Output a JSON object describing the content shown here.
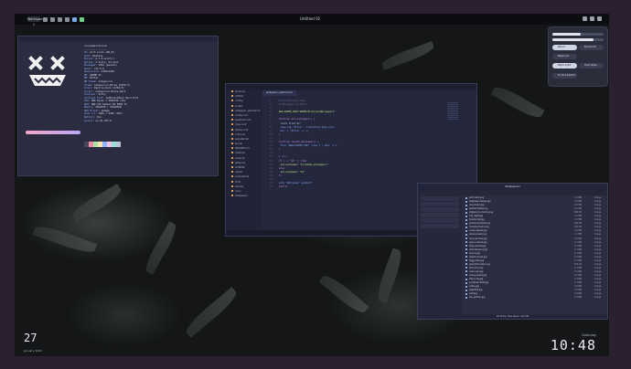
{
  "topbar": {
    "workspace_label": "Workspace 1",
    "window_title": "Untitled 01"
  },
  "neofetch": {
    "lines": [
      {
        "k": "",
        "v": "vivian@archlinux"
      },
      {
        "k": "",
        "v": "----------------"
      },
      {
        "k": "OS: ",
        "v": "Arch Linux x86_64"
      },
      {
        "k": "Host: ",
        "v": "Desktop"
      },
      {
        "k": "Kernel: ",
        "v": "6.7.0-arch3-1"
      },
      {
        "k": "Uptime: ",
        "v": "3 hours, 22 mins"
      },
      {
        "k": "Packages: ",
        "v": "1094 (pacman)"
      },
      {
        "k": "Shell: ",
        "v": "zsh 5.9"
      },
      {
        "k": "Resolution: ",
        "v": "2560x1440"
      },
      {
        "k": "DE: ",
        "v": "GNOME 45"
      },
      {
        "k": "WM: ",
        "v": "Mutter"
      },
      {
        "k": "WM Theme: ",
        "v": "Catppuccin"
      },
      {
        "k": "Theme: ",
        "v": "Catppuccin-Mocha [GTK2/3]"
      },
      {
        "k": "Icons: ",
        "v": "Papirus-Dark [GTK2/3]"
      },
      {
        "k": "Cursor: ",
        "v": "Catppuccin-Mocha-Dark"
      },
      {
        "k": "Terminal: ",
        "v": "kitty"
      },
      {
        "k": "Terminal Font: ",
        "v": "JetBrainsMono Nerd Font"
      },
      {
        "k": "CPU: ",
        "v": "AMD Ryzen 7 5800X3D (16)"
      },
      {
        "k": "GPU: ",
        "v": "AMD ATI Radeon RX 6800 XT"
      },
      {
        "k": "Memory: ",
        "v": "4812MiB / 32030MiB"
      },
      {
        "k": "GPU Driver: ",
        "v": "amdgpu"
      },
      {
        "k": "Disk (/): ",
        "v": "182G / 930G (20%)"
      },
      {
        "k": "Battery: ",
        "v": "N/A"
      },
      {
        "k": "Locale: ",
        "v": "en_US.UTF-8"
      }
    ],
    "swatch_colors": [
      "#45475a",
      "#f38ba8",
      "#a6e3a1",
      "#f9e2af",
      "#89b4fa",
      "#f5c2e7",
      "#94e2d5",
      "#bac2de"
    ]
  },
  "editor": {
    "tab_label": "wallpaper_switcher.sh",
    "sidebar_items": [
      "archlinux",
      "dotfiles",
      ".config",
      "scripts",
      "wallpaper_switcher.sh",
      "config.conf",
      "keybinds.conf",
      "rules.conf",
      "theme.conf",
      "colors.sh",
      "autostart.sh",
      "env.sh",
      "README.md",
      "install.sh",
      "setup.sh",
      "gitignore",
      "LICENSE",
      "assets",
      "screenshots",
      "fonts",
      "themes",
      "icons",
      "wallpapers"
    ],
    "code_lines": [
      {
        "n": "1",
        "t": "#!/usr/bin/env bash",
        "c": "cm"
      },
      {
        "n": "2",
        "t": "# wallpaper switcher",
        "c": "cm"
      },
      {
        "n": "3",
        "t": "",
        "c": ""
      },
      {
        "n": "4",
        "t": "WALLPAPER_DIR=\"$HOME/Pictures/Wallpapers\"",
        "c": "str"
      },
      {
        "n": "5",
        "t": "",
        "c": ""
      },
      {
        "n": "6",
        "t": "function set_wallpaper() {",
        "c": "kw"
      },
      {
        "n": "7",
        "t": "    local file=\"$1\"",
        "c": ""
      },
      {
        "n": "8",
        "t": "    swww img \"$file\" --transition-type grow",
        "c": "fn"
      },
      {
        "n": "9",
        "t": "    wal -i \"$file\" -n -q",
        "c": "fn"
      },
      {
        "n": "10",
        "t": "}",
        "c": "kw"
      },
      {
        "n": "11",
        "t": "",
        "c": ""
      },
      {
        "n": "12",
        "t": "function random_wallpaper() {",
        "c": "kw"
      },
      {
        "n": "13",
        "t": "    find \"$WALLPAPER_DIR\" -type f | shuf -n 1",
        "c": "fn"
      },
      {
        "n": "14",
        "t": "}",
        "c": "kw"
      },
      {
        "n": "15",
        "t": "",
        "c": ""
      },
      {
        "n": "16",
        "t": "# main",
        "c": "cm"
      },
      {
        "n": "17",
        "t": "if [ -z \"$1\" ]; then",
        "c": "kw"
      },
      {
        "n": "18",
        "t": "    set_wallpaper \"$(random_wallpaper)\"",
        "c": "str"
      },
      {
        "n": "19",
        "t": "else",
        "c": "kw"
      },
      {
        "n": "20",
        "t": "    set_wallpaper \"$1\"",
        "c": "str"
      },
      {
        "n": "21",
        "t": "fi",
        "c": "kw"
      },
      {
        "n": "22",
        "t": "",
        "c": ""
      },
      {
        "n": "23",
        "t": "echo \"Wallpaper updated\"",
        "c": "fn"
      },
      {
        "n": "24",
        "t": "exit 0",
        "c": "kw"
      }
    ]
  },
  "filemanager": {
    "title": "Wallpapers",
    "files": [
      {
        "n": "arch-dark.png",
        "s": "1.2 MB",
        "t": "Image"
      },
      {
        "n": "wallpaper-leaves.jpg",
        "s": "3.4 MB",
        "t": "Image"
      },
      {
        "n": "mountains.jpg",
        "s": "2.8 MB",
        "t": "Image"
      },
      {
        "n": "abstract-flow.png",
        "s": "4.1 MB",
        "t": "Image"
      },
      {
        "n": "catppuccin-mocha.png",
        "s": "980 kB",
        "t": "Image"
      },
      {
        "n": "city-night.jpg",
        "s": "2.2 MB",
        "t": "Image"
      },
      {
        "n": "forest-mist.jpg",
        "s": "3.0 MB",
        "t": "Image"
      },
      {
        "n": "gradient-purple.png",
        "s": "620 kB",
        "t": "Image"
      },
      {
        "n": "minimal-moon.png",
        "s": "450 kB",
        "t": "Image"
      },
      {
        "n": "ocean-waves.jpg",
        "s": "2.6 MB",
        "t": "Image"
      },
      {
        "n": "pixel-sunset.png",
        "s": "1.1 MB",
        "t": "Image"
      },
      {
        "n": "rainy-window.jpg",
        "s": "2.9 MB",
        "t": "Image"
      },
      {
        "n": "space-nebula.jpg",
        "s": "5.2 MB",
        "t": "Image"
      },
      {
        "n": "tokyo-street.jpg",
        "s": "3.3 MB",
        "t": "Image"
      },
      {
        "n": "dark-leaves-2.jpg",
        "s": "3.7 MB",
        "t": "Image"
      },
      {
        "n": "aurora.jpg",
        "s": "2.4 MB",
        "t": "Image"
      },
      {
        "n": "desert-dunes.jpg",
        "s": "1.9 MB",
        "t": "Image"
      },
      {
        "n": "foggy-lake.jpg",
        "s": "2.1 MB",
        "t": "Image"
      },
      {
        "n": "geometric-dark.png",
        "s": "870 kB",
        "t": "Image"
      },
      {
        "n": "lofi-room.png",
        "s": "1.5 MB",
        "t": "Image"
      },
      {
        "n": "neon-rain.jpg",
        "s": "3.1 MB",
        "t": "Image"
      },
      {
        "n": "snowy-peaks.jpg",
        "s": "2.7 MB",
        "t": "Image"
      },
      {
        "n": "starry-sky.jpg",
        "s": "3.9 MB",
        "t": "Image"
      },
      {
        "n": "sunflower-field.jpg",
        "s": "2.3 MB",
        "t": "Image"
      },
      {
        "n": "valley.jpg",
        "s": "2.0 MB",
        "t": "Image"
      },
      {
        "n": "waterfall.jpg",
        "s": "3.5 MB",
        "t": "Image"
      },
      {
        "n": "wolf.jpg",
        "s": "1.8 MB",
        "t": "Image"
      },
      {
        "n": "zen-garden.jpg",
        "s": "2.5 MB",
        "t": "Image"
      }
    ],
    "status": "28 items, Free space: 412 GB"
  },
  "quicksettings": {
    "wifi": "Wired",
    "bluetooth": "Bluetooth",
    "power": "Balanced",
    "night_light": "Night Light",
    "dark_style": "Dark Style",
    "do_not_disturb": "Do Not Disturb",
    "volume_level": 0.55,
    "brightness_level": 0.8
  },
  "clock": {
    "time": "10:48",
    "label": "Saturday",
    "date_num": "27",
    "date_sub": "January 2024"
  }
}
